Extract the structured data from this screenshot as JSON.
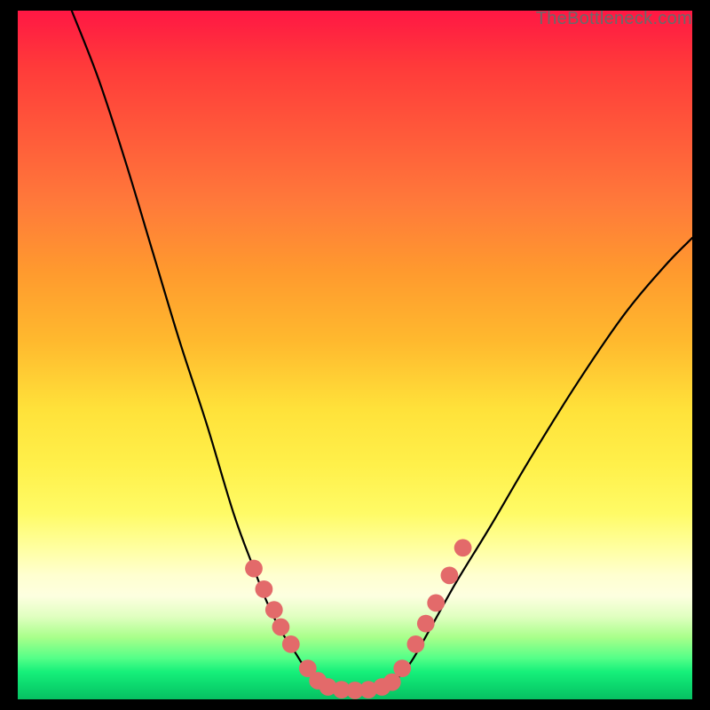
{
  "attribution": "TheBottleneck.com",
  "chart_data": {
    "type": "line",
    "title": "",
    "xlabel": "",
    "ylabel": "",
    "xlim": [
      0,
      100
    ],
    "ylim": [
      0,
      100
    ],
    "grid": false,
    "legend": false,
    "background_gradient_stops": [
      {
        "pos": 0,
        "color": "#ff1744"
      },
      {
        "pos": 8,
        "color": "#ff3a3a"
      },
      {
        "pos": 18,
        "color": "#ff5a3a"
      },
      {
        "pos": 28,
        "color": "#ff7a3a"
      },
      {
        "pos": 38,
        "color": "#ff9a2e"
      },
      {
        "pos": 48,
        "color": "#ffb92e"
      },
      {
        "pos": 58,
        "color": "#ffe23a"
      },
      {
        "pos": 66,
        "color": "#fff04a"
      },
      {
        "pos": 73,
        "color": "#fffb66"
      },
      {
        "pos": 78,
        "color": "#ffffa0"
      },
      {
        "pos": 82,
        "color": "#ffffd0"
      },
      {
        "pos": 85,
        "color": "#fdffe0"
      },
      {
        "pos": 88,
        "color": "#e0ffc0"
      },
      {
        "pos": 91,
        "color": "#a8ff8a"
      },
      {
        "pos": 94,
        "color": "#55ff88"
      },
      {
        "pos": 96,
        "color": "#16f07a"
      },
      {
        "pos": 98,
        "color": "#0cd86e"
      },
      {
        "pos": 100,
        "color": "#07c062"
      }
    ],
    "series": [
      {
        "name": "left-branch",
        "stroke": "#000000",
        "x": [
          8,
          12,
          16,
          20,
          24,
          28,
          32,
          35,
          37,
          39,
          41,
          43,
          45
        ],
        "y": [
          100,
          90,
          78,
          65,
          52,
          40,
          27,
          19,
          14,
          10,
          7,
          4,
          2
        ]
      },
      {
        "name": "valley-floor",
        "stroke": "#000000",
        "x": [
          45,
          47,
          49,
          51,
          53,
          55
        ],
        "y": [
          2,
          1.5,
          1.3,
          1.3,
          1.5,
          2
        ]
      },
      {
        "name": "right-branch",
        "stroke": "#000000",
        "x": [
          55,
          58,
          61,
          65,
          70,
          76,
          83,
          90,
          96,
          100
        ],
        "y": [
          2,
          5,
          10,
          17,
          25,
          35,
          46,
          56,
          63,
          67
        ]
      }
    ],
    "markers": {
      "color": "#e36a6a",
      "radius": 1.3,
      "points": [
        {
          "x": 35,
          "y": 19
        },
        {
          "x": 36.5,
          "y": 16
        },
        {
          "x": 38,
          "y": 13
        },
        {
          "x": 39,
          "y": 10.5
        },
        {
          "x": 40.5,
          "y": 8
        },
        {
          "x": 43,
          "y": 4.5
        },
        {
          "x": 44.5,
          "y": 2.7
        },
        {
          "x": 46,
          "y": 1.8
        },
        {
          "x": 48,
          "y": 1.4
        },
        {
          "x": 50,
          "y": 1.3
        },
        {
          "x": 52,
          "y": 1.4
        },
        {
          "x": 54,
          "y": 1.8
        },
        {
          "x": 55.5,
          "y": 2.5
        },
        {
          "x": 57,
          "y": 4.5
        },
        {
          "x": 59,
          "y": 8
        },
        {
          "x": 60.5,
          "y": 11
        },
        {
          "x": 62,
          "y": 14
        },
        {
          "x": 64,
          "y": 18
        },
        {
          "x": 66,
          "y": 22
        }
      ]
    }
  }
}
